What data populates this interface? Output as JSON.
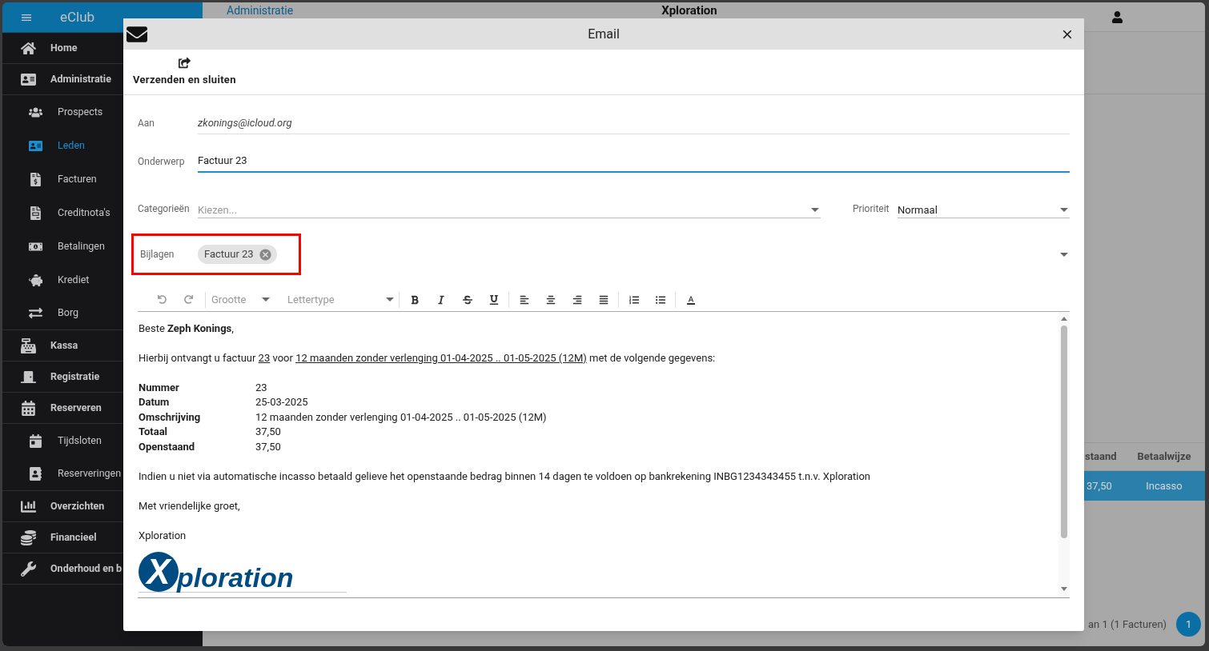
{
  "app": {
    "name": "eClub",
    "header_section": "Administratie",
    "title": "Xploration"
  },
  "sidebar": {
    "items": [
      {
        "kind": "section",
        "label": "Home",
        "selected": false
      },
      {
        "kind": "section",
        "label": "Administratie",
        "selected": false
      },
      {
        "kind": "sub",
        "label": "Prospects",
        "selected": false
      },
      {
        "kind": "sub",
        "label": "Leden",
        "selected": true
      },
      {
        "kind": "sub",
        "label": "Facturen",
        "selected": false
      },
      {
        "kind": "sub",
        "label": "Creditnota's",
        "selected": false
      },
      {
        "kind": "sub",
        "label": "Betalingen",
        "selected": false
      },
      {
        "kind": "sub",
        "label": "Krediet",
        "selected": false
      },
      {
        "kind": "sub",
        "label": "Borg",
        "selected": false
      },
      {
        "kind": "section",
        "label": "Kassa",
        "selected": false
      },
      {
        "kind": "section",
        "label": "Registratie",
        "selected": false
      },
      {
        "kind": "section",
        "label": "Reserveren",
        "selected": false
      },
      {
        "kind": "sub",
        "label": "Tijdsloten",
        "selected": false
      },
      {
        "kind": "sub",
        "label": "Reserveringen",
        "selected": false
      },
      {
        "kind": "section",
        "label": "Overzichten",
        "selected": false
      },
      {
        "kind": "section",
        "label": "Financieel",
        "selected": false
      },
      {
        "kind": "section",
        "label": "Onderhoud en b",
        "selected": false
      }
    ]
  },
  "table": {
    "columns": [
      "staand",
      "Betaalwijze"
    ],
    "rows": [
      {
        "cells": [
          "37,50",
          "Incasso"
        ],
        "selected": true
      }
    ]
  },
  "pagination": {
    "summary": "an 1 (1 Facturen)",
    "pages": [
      {
        "label": "1",
        "selected": true
      }
    ]
  },
  "dialog": {
    "title": "Email",
    "send_button": "Verzenden en sluiten",
    "to": {
      "label": "Aan",
      "value": "zkonings@icloud.org"
    },
    "subject": {
      "label": "Onderwerp",
      "value": "Factuur 23",
      "focused": true
    },
    "categories": {
      "label": "Categorieën",
      "placeholder": "Kiezen..."
    },
    "priority": {
      "label": "Prioriteit",
      "value": "Normaal"
    },
    "attachments": {
      "label": "Bijlagen",
      "highlighted": true,
      "chips": [
        "Factuur 23"
      ]
    },
    "editor": {
      "size_placeholder": "Grootte",
      "font_placeholder": "Lettertype",
      "greeting": "Beste **Zeph Konings**,",
      "intro": [
        {
          "text": "Hierbij ontvangt u factuur ",
          "underline": false
        },
        {
          "text": "23",
          "underline": true
        },
        {
          "text": " voor ",
          "underline": false
        },
        {
          "text": "12 maanden zonder verlenging 01-04-2025 .. 01-05-2025 (12M)",
          "underline": true
        },
        {
          "text": " met de volgende gegevens:",
          "underline": false
        }
      ],
      "details": [
        {
          "label": "Nummer",
          "value": "23"
        },
        {
          "label": "Datum",
          "value": "25-03-2025"
        },
        {
          "label": "Omschrijving",
          "value": "12 maanden zonder verlenging 01-04-2025 .. 01-05-2025 (12M)"
        },
        {
          "label": "Totaal",
          "value": "37,50"
        },
        {
          "label": "Openstaand",
          "value": "37,50"
        }
      ],
      "notice": "Indien u niet via automatische incasso betaald gelieve het openstaande bedrag binnen 14 dagen te voldoen op bankrekening INBG1234343455 t.n.v. Xploration",
      "closing": "Met vriendelijke groet,",
      "signature": "Xploration",
      "logo": {
        "mark": "X",
        "text": "ploration"
      }
    }
  }
}
